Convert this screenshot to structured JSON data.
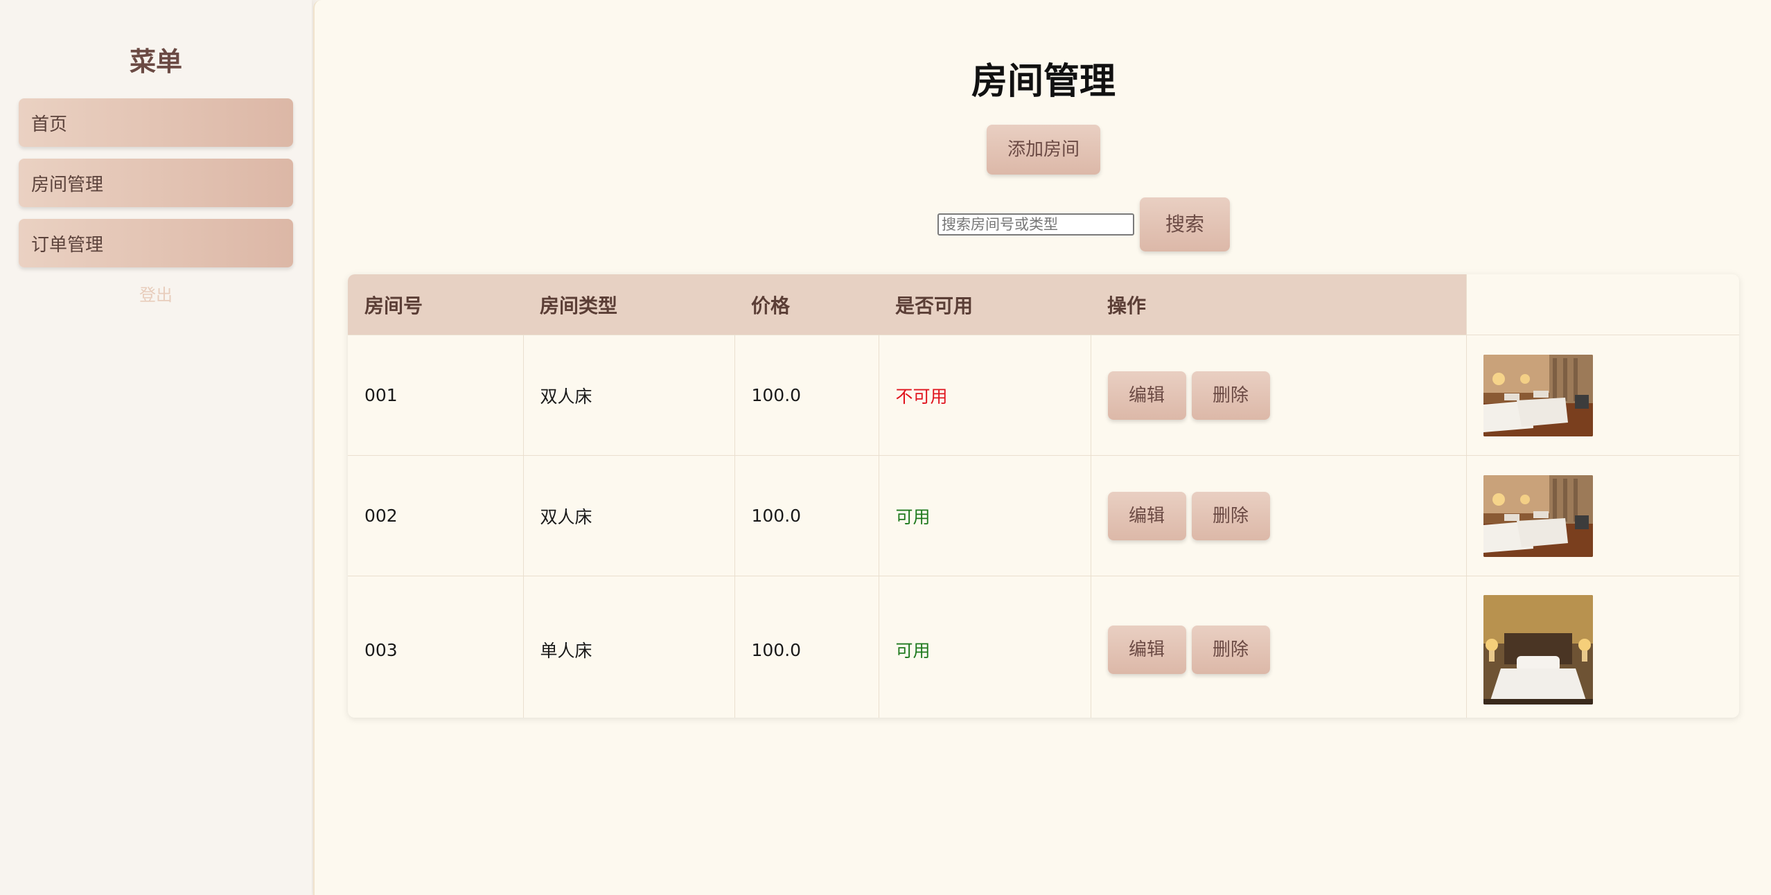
{
  "sidebar": {
    "title": "菜单",
    "items": [
      {
        "label": "首页"
      },
      {
        "label": "房间管理"
      },
      {
        "label": "订单管理"
      }
    ],
    "logout": "登出"
  },
  "main": {
    "title": "房间管理",
    "add_button": "添加房间",
    "search": {
      "placeholder": "搜索房间号或类型",
      "value": "",
      "button": "搜索"
    },
    "table": {
      "headers": [
        "房间号",
        "房间类型",
        "价格",
        "是否可用",
        "操作",
        ""
      ],
      "rows": [
        {
          "room_no": "001",
          "type": "双人床",
          "price": "100.0",
          "available": "不可用",
          "edit": "编辑",
          "delete": "删除",
          "photo": "twin-bed-room-photo"
        },
        {
          "room_no": "002",
          "type": "双人床",
          "price": "100.0",
          "available": "可用",
          "edit": "编辑",
          "delete": "删除",
          "photo": "twin-bed-room-photo"
        },
        {
          "room_no": "003",
          "type": "单人床",
          "price": "100.0",
          "available": "可用",
          "edit": "编辑",
          "delete": "删除",
          "photo": "single-bed-room-photo"
        }
      ]
    }
  },
  "colors": {
    "accent_button": "#e2c2b3",
    "unavailable": "#e0141e",
    "available": "#1f7a1f",
    "header_bg": "#e7d1c3"
  }
}
